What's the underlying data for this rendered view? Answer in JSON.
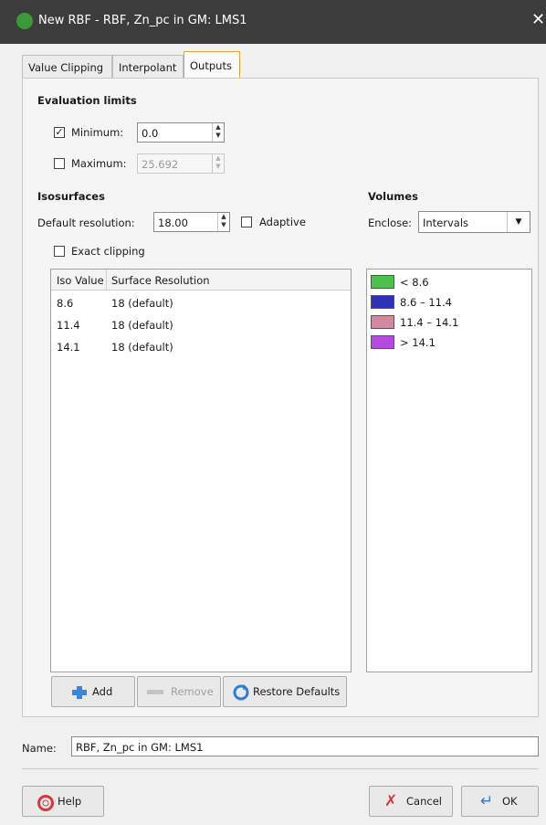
{
  "window": {
    "title": "New RBF - RBF, Zn_pc in GM: LMS1",
    "close_glyph": "✕"
  },
  "tabs": [
    {
      "label": "Value Clipping"
    },
    {
      "label": "Interpolant"
    },
    {
      "label": "Outputs",
      "active": true
    }
  ],
  "evaluation": {
    "heading": "Evaluation limits",
    "minimum": {
      "label": "Minimum:",
      "checked": true,
      "value": "0.0"
    },
    "maximum": {
      "label": "Maximum:",
      "checked": false,
      "value": "25.692"
    }
  },
  "isosurfaces": {
    "heading": "Isosurfaces",
    "default_resolution_label": "Default resolution:",
    "default_resolution_value": "18.00",
    "adaptive_label": "Adaptive",
    "exact_clipping_label": "Exact clipping",
    "columns": [
      "Iso Value",
      "Surface Resolution"
    ],
    "rows": [
      {
        "iso": "8.6",
        "res": "18 (default)"
      },
      {
        "iso": "11.4",
        "res": "18 (default)"
      },
      {
        "iso": "14.1",
        "res": "18 (default)"
      }
    ]
  },
  "volumes": {
    "heading": "Volumes",
    "enclose_label": "Enclose:",
    "enclose_value": "Intervals",
    "legend": [
      {
        "label": "< 8.6",
        "color": "#4cc24c"
      },
      {
        "label": "8.6 – 11.4",
        "color": "#3030b8"
      },
      {
        "label": "11.4 – 14.1",
        "color": "#d08aa0"
      },
      {
        "label": "> 14.1",
        "color": "#b64ae0"
      }
    ]
  },
  "buttons": {
    "add": "Add",
    "remove": "Remove",
    "restore": "Restore Defaults",
    "help": "Help",
    "cancel": "Cancel",
    "ok": "OK"
  },
  "name": {
    "label": "Name:",
    "value": "RBF, Zn_pc in GM: LMS1"
  }
}
